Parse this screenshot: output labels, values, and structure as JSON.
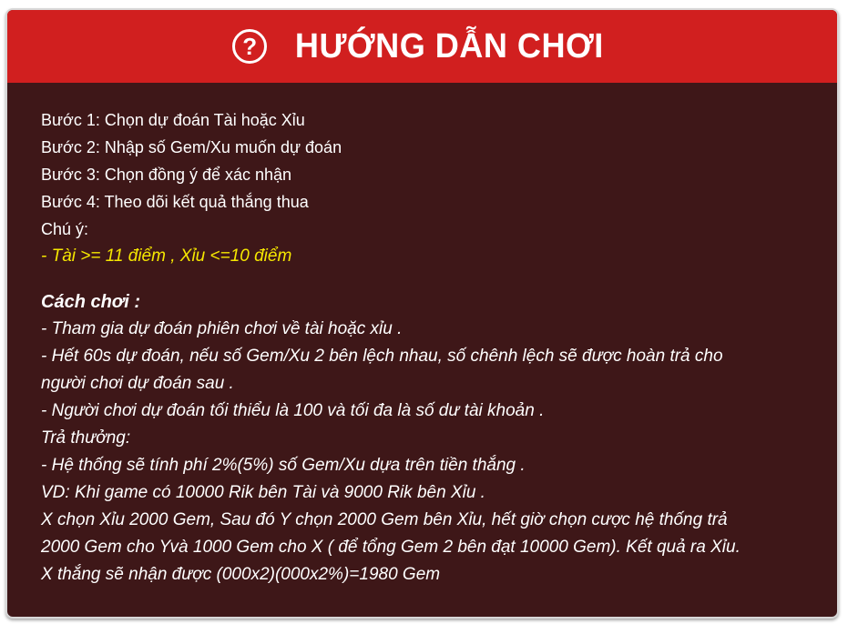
{
  "header": {
    "icon": "question-circle-icon",
    "title": "HƯỚNG DẪN CHƠI"
  },
  "steps": [
    "Bước 1: Chọn dự đoán Tài hoặc Xỉu",
    "Bước 2: Nhập số Gem/Xu muốn dự đoán",
    "Bước 3: Chọn đồng ý để xác nhận",
    "Bước 4: Theo dõi kết quả thắng thua"
  ],
  "note_label": "Chú ý:",
  "note": "- Tài >= 11 điểm , Xỉu <=10 điểm",
  "rules_heading": "Cách chơi :",
  "rules": [
    "- Tham gia dự đoán phiên chơi về tài hoặc xỉu .",
    "- Hết 60s dự đoán, nếu số Gem/Xu 2 bên lệch nhau, số chênh lệch sẽ được hoàn trả cho",
    "người chơi dự đoán sau .",
    "- Người chơi dự đoán tối thiểu là 100 và tối đa là số dư tài khoản .",
    "Trả thưởng:",
    "- Hệ thống sẽ tính phí 2%(5%) số Gem/Xu dựa trên tiền thắng .",
    "VD: Khi game có 10000 Rik bên Tài và 9000 Rik bên Xỉu .",
    "X chọn Xỉu 2000 Gem, Sau đó Y chọn 2000 Gem bên Xỉu, hết giờ chọn cược hệ thống trả",
    "2000 Gem cho Yvà 1000 Gem cho X ( để tổng Gem 2 bên đạt 10000 Gem). Kết quả ra Xỉu.",
    "X thắng sẽ nhận được (000x2)(000x2%)=1980 Gem"
  ],
  "colors": {
    "header": "#d11f1f",
    "body": "#3e1718",
    "highlight": "#f6e800"
  }
}
